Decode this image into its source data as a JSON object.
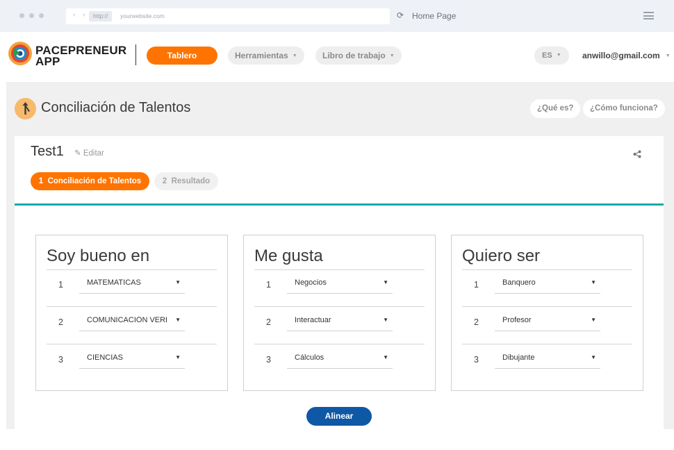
{
  "browser": {
    "url_protocol": "http://",
    "url": "yourwebsite.com",
    "home_label": "Home Page"
  },
  "header": {
    "logo_line1": "PACEPRENEUR",
    "logo_line2": "APP",
    "nav": {
      "tablero": "Tablero",
      "herramientas": "Herramientas",
      "libro": "Libro de trabajo"
    },
    "language": "ES",
    "user_email": "anwillo@gmail.com"
  },
  "page": {
    "title": "Conciliación de Talentos",
    "help_que": "¿Qué es?",
    "help_como": "¿Cómo funciona?"
  },
  "card": {
    "title": "Test1",
    "edit_label": "Editar",
    "steps": [
      {
        "num": "1",
        "label": "Conciliación de Talentos",
        "active": true
      },
      {
        "num": "2",
        "label": "Resultado",
        "active": false
      }
    ]
  },
  "columns": [
    {
      "title": "Soy bueno en",
      "rows": [
        {
          "num": "1",
          "value": "MATEMATICAS"
        },
        {
          "num": "2",
          "value": "COMUNICACIÓN VERBAL"
        },
        {
          "num": "3",
          "value": "CIENCIAS"
        }
      ]
    },
    {
      "title": "Me gusta",
      "rows": [
        {
          "num": "1",
          "value": "Negocios"
        },
        {
          "num": "2",
          "value": "Interactuar"
        },
        {
          "num": "3",
          "value": "Cálculos"
        }
      ]
    },
    {
      "title": "Quiero ser",
      "rows": [
        {
          "num": "1",
          "value": "Banquero"
        },
        {
          "num": "2",
          "value": "Profesor"
        },
        {
          "num": "3",
          "value": "Dibujante"
        }
      ]
    }
  ],
  "actions": {
    "align_label": "Alinear"
  },
  "colors": {
    "accent_orange": "#ff7400",
    "teal": "#17a9a9",
    "primary_blue": "#0f58a6"
  },
  "icons": {
    "reload": "reload-icon",
    "menu": "hamburger-menu-icon",
    "edit": "edit-icon",
    "share": "share-icon",
    "page": "talent-arrow-icon"
  }
}
